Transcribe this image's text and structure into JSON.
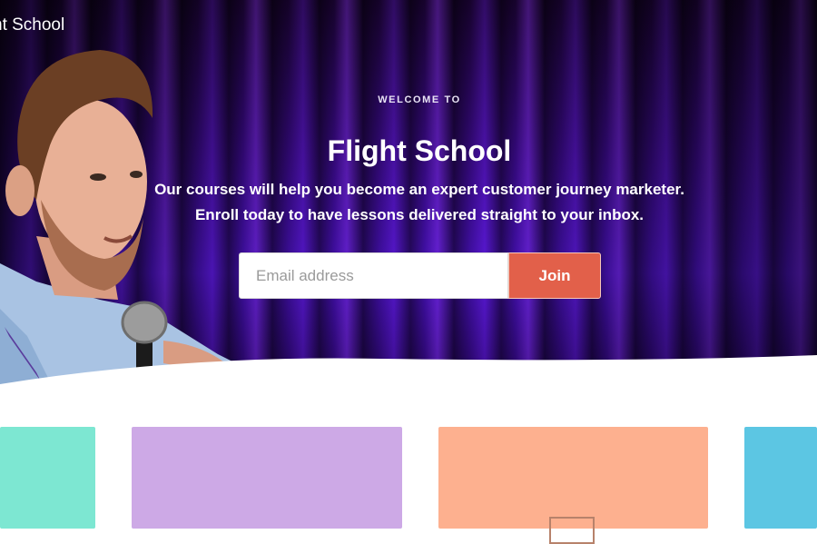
{
  "header": {
    "brand": "ht School"
  },
  "hero": {
    "kicker": "WELCOME TO",
    "title": "Flight School",
    "subtitle_line1": "Our courses will help you become an expert customer journey marketer.",
    "subtitle_line2": "Enroll today to have lessons delivered straight to your inbox."
  },
  "signup": {
    "email_placeholder": "Email address",
    "email_value": "",
    "join_label": "Join"
  },
  "colors": {
    "join_button": "#e2604a",
    "hero_purple": "#4c12c4",
    "card_teal": "#7de7d2",
    "card_lavender": "#cda9e6",
    "card_peach": "#fdb08f",
    "card_blue": "#5cc6e3"
  },
  "cards": [
    {
      "color": "#7de7d2"
    },
    {
      "color": "#cda9e6"
    },
    {
      "color": "#fdb08f",
      "icon": "image-placeholder-icon"
    },
    {
      "color": "#5cc6e3"
    }
  ]
}
